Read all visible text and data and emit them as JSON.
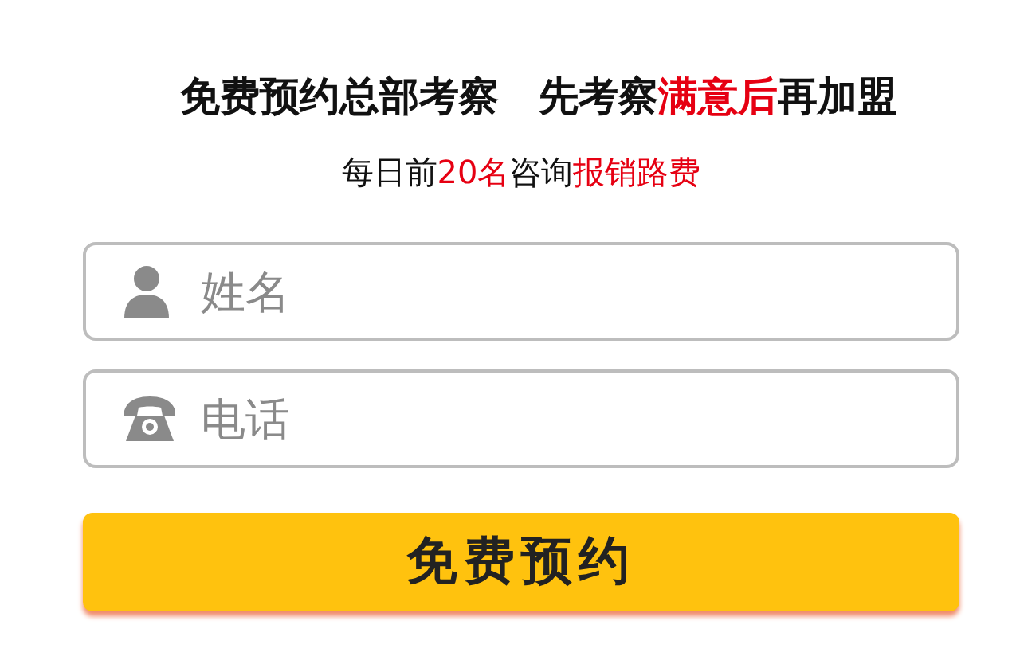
{
  "headline": [
    {
      "text": "免费预约总部考察　先考察",
      "highlight": false
    },
    {
      "text": "满意后",
      "highlight": true
    },
    {
      "text": "再加盟",
      "highlight": false
    }
  ],
  "subline": [
    {
      "text": "每日前",
      "highlight": false
    },
    {
      "text": "20名",
      "highlight": true
    },
    {
      "text": "咨询",
      "highlight": false
    },
    {
      "text": "报销路费",
      "highlight": true
    }
  ],
  "fields": [
    {
      "kind": "person",
      "placeholder": "姓名"
    },
    {
      "kind": "phone",
      "placeholder": "电话"
    }
  ],
  "submit": {
    "label": "免费预约"
  }
}
